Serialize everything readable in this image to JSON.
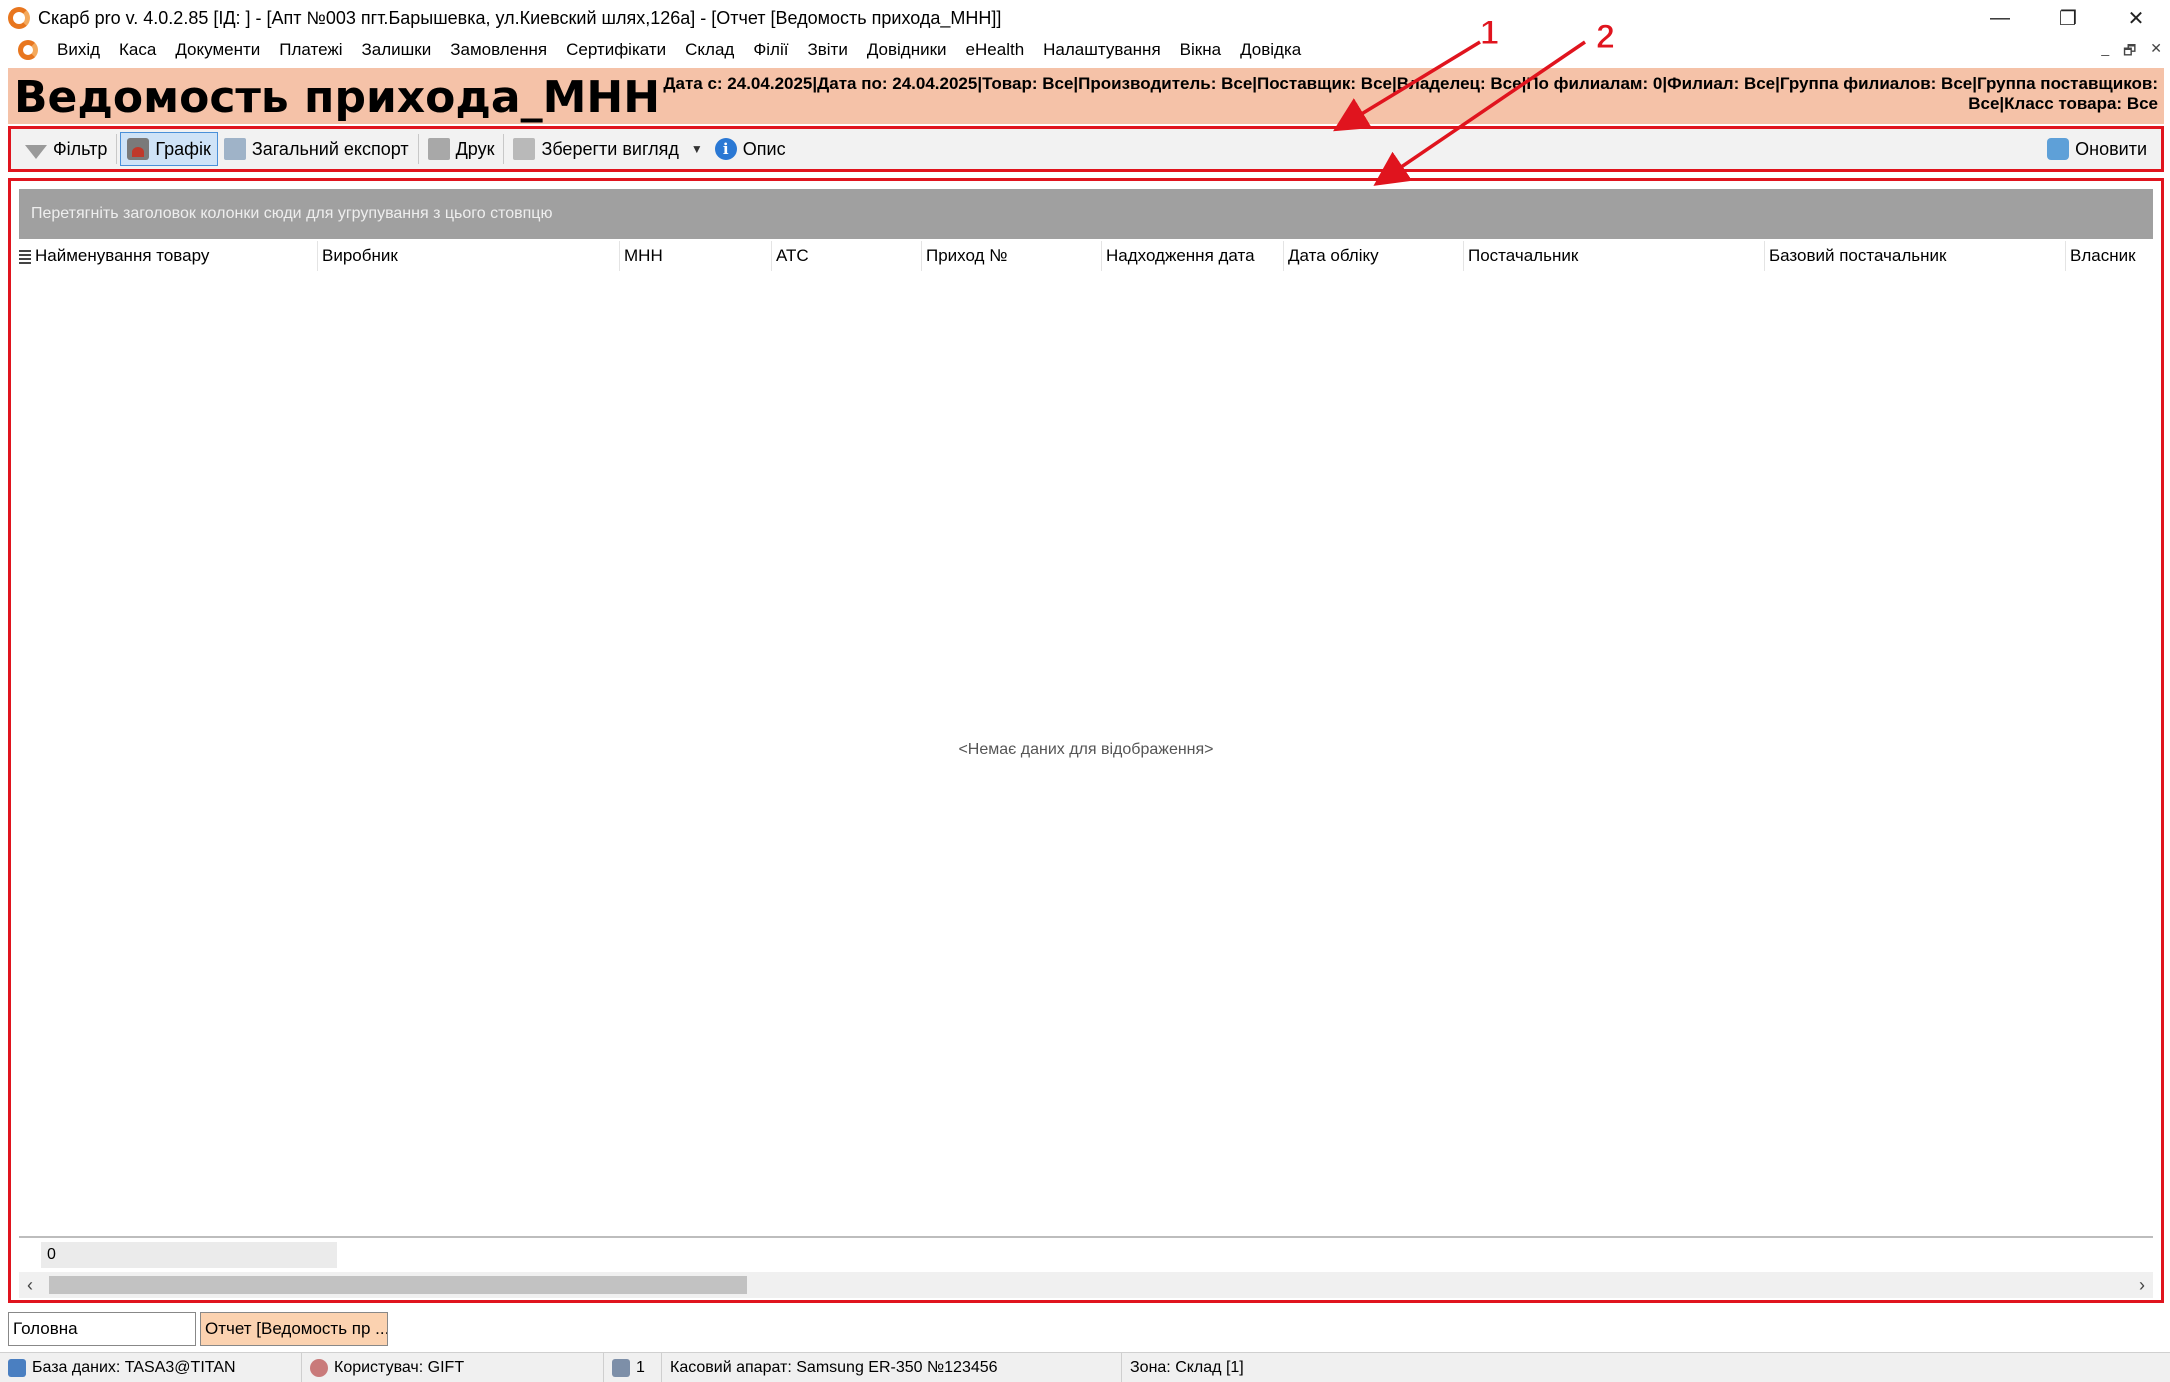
{
  "window": {
    "title": "Скарб pro v. 4.0.2.85 [ІД:       ] - [Апт №003 пгт.Барышевка, ул.Киевский шлях,126а] - [Отчет [Ведомость прихода_МНН]]",
    "minimize": "—",
    "restore": "❐",
    "close": "✕"
  },
  "menu": {
    "items": [
      "Вихід",
      "Каса",
      "Документи",
      "Платежі",
      "Залишки",
      "Замовлення",
      "Сертифікати",
      "Склад",
      "Філії",
      "Звіти",
      "Довідники",
      "eHealth",
      "Налаштування",
      "Вікна",
      "Довідка"
    ],
    "mdi_minimize": "_",
    "mdi_restore": "🗗",
    "mdi_close": "✕"
  },
  "report": {
    "title": "Ведомость прихода_МНН",
    "params_line1": "Дата с: 24.04.2025|Дата по: 24.04.2025|Товар: Все|Производитель: Все|Поставщик: Все|Владелец: Все|По филиалам: 0|Филиал: Все|Группа филиалов: Все|Группа поставщиков:",
    "params_line2": "Все|Класс товара: Все"
  },
  "toolbar": {
    "filter": "Фільтр",
    "chart": "Графік",
    "export": "Загальний експорт",
    "print": "Друк",
    "save_view": "Зберегти вигляд",
    "description": "Опис",
    "refresh": "Оновити",
    "info_glyph": "i"
  },
  "grid": {
    "group_hint": "Перетягніть заголовок колонки сюди для угрупування з цього стовпцю",
    "columns": [
      "Найменування товару",
      "Виробник",
      "МНН",
      "АТС",
      "Приход №",
      "Надходження дата",
      "Дата обліку",
      "Постачальник",
      "Базовий постачальник",
      "Власник"
    ],
    "empty_message": "<Немає даних для відображення>",
    "footer_count": "0"
  },
  "tabs": [
    "Головна",
    "Отчет [Ведомость пр ..."
  ],
  "status": {
    "database": "База даних: TASA3@TITAN",
    "user": "Користувач: GIFT",
    "queue": "1",
    "register": "Касовий апарат: Samsung ER-350 №123456",
    "zone": "Зона: Склад [1]"
  },
  "annotations": {
    "label1": "1",
    "label2": "2",
    "color": "#e0141e"
  }
}
